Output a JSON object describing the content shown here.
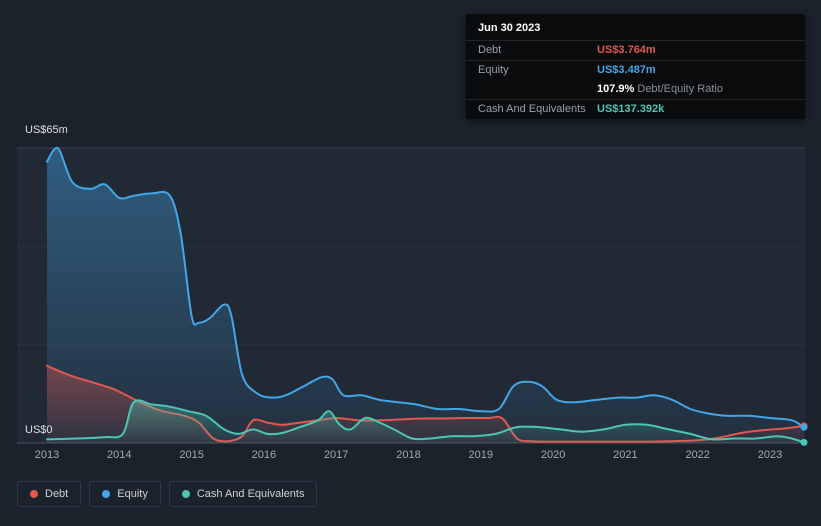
{
  "tooltip": {
    "date": "Jun 30 2023",
    "debt_label": "Debt",
    "debt_value": "US$3.764m",
    "equity_label": "Equity",
    "equity_value": "US$3.487m",
    "ratio_value": "107.9%",
    "ratio_suffix": "Debt/Equity Ratio",
    "cash_label": "Cash And Equivalents",
    "cash_value": "US$137.392k"
  },
  "axis": {
    "y_top_label": "US$65m",
    "y_zero_label": "US$0"
  },
  "legend": {
    "items": [
      {
        "label": "Debt",
        "color": "#e2574e"
      },
      {
        "label": "Equity",
        "color": "#43a6e8"
      },
      {
        "label": "Cash And Equivalents",
        "color": "#4cc5b2"
      }
    ]
  },
  "chart_data": {
    "type": "area",
    "unit": "US$ millions",
    "x_range": [
      2013,
      2023.5
    ],
    "y_range": [
      0,
      65
    ],
    "x_tick_years": [
      "2013",
      "2014",
      "2015",
      "2016",
      "2017",
      "2018",
      "2019",
      "2020",
      "2021",
      "2022",
      "2023"
    ],
    "y_tick_labels": [
      "US$0",
      "US$65m"
    ],
    "grid": true,
    "legend_position": "bottom-left",
    "series": [
      {
        "name": "Equity",
        "color": "#43a6e8",
        "points": [
          [
            2013.0,
            62
          ],
          [
            2013.15,
            65
          ],
          [
            2013.35,
            57.5
          ],
          [
            2013.6,
            56
          ],
          [
            2013.8,
            57
          ],
          [
            2014.0,
            54
          ],
          [
            2014.2,
            54.5
          ],
          [
            2014.45,
            55
          ],
          [
            2014.7,
            54.5
          ],
          [
            2014.85,
            46
          ],
          [
            2015.0,
            28
          ],
          [
            2015.1,
            26.5
          ],
          [
            2015.25,
            27.5
          ],
          [
            2015.45,
            30.5
          ],
          [
            2015.55,
            28
          ],
          [
            2015.7,
            15
          ],
          [
            2015.9,
            11
          ],
          [
            2016.1,
            10
          ],
          [
            2016.3,
            10.5
          ],
          [
            2016.55,
            12.5
          ],
          [
            2016.8,
            14.5
          ],
          [
            2016.95,
            14
          ],
          [
            2017.1,
            10.5
          ],
          [
            2017.35,
            10.5
          ],
          [
            2017.6,
            9.5
          ],
          [
            2017.85,
            9
          ],
          [
            2018.1,
            8.5
          ],
          [
            2018.4,
            7.5
          ],
          [
            2018.7,
            7.5
          ],
          [
            2019.0,
            7
          ],
          [
            2019.25,
            7.5
          ],
          [
            2019.45,
            12.5
          ],
          [
            2019.65,
            13.5
          ],
          [
            2019.85,
            12.5
          ],
          [
            2020.05,
            9.5
          ],
          [
            2020.3,
            9
          ],
          [
            2020.6,
            9.5
          ],
          [
            2020.9,
            10
          ],
          [
            2021.15,
            10
          ],
          [
            2021.4,
            10.5
          ],
          [
            2021.65,
            9.5
          ],
          [
            2021.9,
            7.5
          ],
          [
            2022.15,
            6.5
          ],
          [
            2022.4,
            6
          ],
          [
            2022.7,
            6
          ],
          [
            2023.0,
            5.5
          ],
          [
            2023.3,
            5
          ],
          [
            2023.5,
            3.487
          ]
        ]
      },
      {
        "name": "Debt",
        "color": "#e2574e",
        "points": [
          [
            2013.0,
            17
          ],
          [
            2013.3,
            15
          ],
          [
            2013.6,
            13.5
          ],
          [
            2013.9,
            12
          ],
          [
            2014.1,
            10.5
          ],
          [
            2014.35,
            8.5
          ],
          [
            2014.6,
            7
          ],
          [
            2014.9,
            6
          ],
          [
            2015.1,
            4.5
          ],
          [
            2015.3,
            1
          ],
          [
            2015.5,
            0.4
          ],
          [
            2015.7,
            1.5
          ],
          [
            2015.85,
            5
          ],
          [
            2016.05,
            4.5
          ],
          [
            2016.25,
            4
          ],
          [
            2016.5,
            4.5
          ],
          [
            2016.75,
            5
          ],
          [
            2017.0,
            5.5
          ],
          [
            2017.3,
            5
          ],
          [
            2017.6,
            5
          ],
          [
            2017.9,
            5.2
          ],
          [
            2018.2,
            5.4
          ],
          [
            2018.5,
            5.4
          ],
          [
            2018.8,
            5.5
          ],
          [
            2019.1,
            5.5
          ],
          [
            2019.3,
            5.4
          ],
          [
            2019.5,
            1
          ],
          [
            2019.7,
            0.4
          ],
          [
            2020.0,
            0.3
          ],
          [
            2020.4,
            0.3
          ],
          [
            2020.8,
            0.3
          ],
          [
            2021.2,
            0.3
          ],
          [
            2021.6,
            0.4
          ],
          [
            2022.0,
            0.6
          ],
          [
            2022.3,
            1.2
          ],
          [
            2022.6,
            2.2
          ],
          [
            2022.9,
            2.8
          ],
          [
            2023.2,
            3.2
          ],
          [
            2023.5,
            3.764
          ]
        ]
      },
      {
        "name": "Cash And Equivalents",
        "color": "#4cc5b2",
        "points": [
          [
            2013.0,
            0.8
          ],
          [
            2013.4,
            1
          ],
          [
            2013.8,
            1.3
          ],
          [
            2014.05,
            2
          ],
          [
            2014.2,
            9
          ],
          [
            2014.45,
            8.5
          ],
          [
            2014.7,
            8
          ],
          [
            2014.95,
            7
          ],
          [
            2015.2,
            6
          ],
          [
            2015.45,
            3
          ],
          [
            2015.65,
            2
          ],
          [
            2015.85,
            3
          ],
          [
            2016.05,
            2
          ],
          [
            2016.25,
            2.2
          ],
          [
            2016.5,
            3.5
          ],
          [
            2016.75,
            5
          ],
          [
            2016.9,
            7
          ],
          [
            2017.05,
            4
          ],
          [
            2017.2,
            3
          ],
          [
            2017.4,
            5.5
          ],
          [
            2017.6,
            4.5
          ],
          [
            2017.8,
            3
          ],
          [
            2018.05,
            1
          ],
          [
            2018.3,
            1
          ],
          [
            2018.6,
            1.5
          ],
          [
            2018.9,
            1.5
          ],
          [
            2019.2,
            2
          ],
          [
            2019.5,
            3.5
          ],
          [
            2019.8,
            3.5
          ],
          [
            2020.1,
            3
          ],
          [
            2020.4,
            2.5
          ],
          [
            2020.7,
            3
          ],
          [
            2021.0,
            4
          ],
          [
            2021.3,
            4
          ],
          [
            2021.6,
            3
          ],
          [
            2021.9,
            2
          ],
          [
            2022.2,
            0.8
          ],
          [
            2022.5,
            1
          ],
          [
            2022.8,
            1
          ],
          [
            2023.1,
            1.5
          ],
          [
            2023.3,
            1
          ],
          [
            2023.5,
            0.137
          ]
        ]
      }
    ]
  }
}
